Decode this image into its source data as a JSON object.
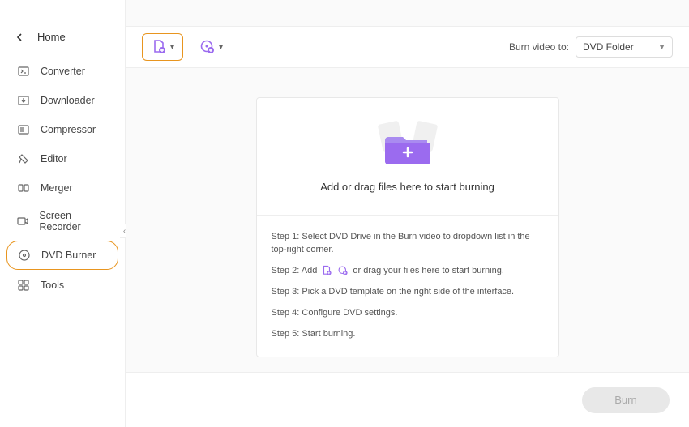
{
  "titlebar": {
    "avatar_icon": "user-avatar",
    "headset_icon": "headset-icon",
    "menu_icon": "hamburger-icon"
  },
  "sidebar": {
    "home_label": "Home",
    "items": [
      {
        "icon": "converter-icon",
        "label": "Converter"
      },
      {
        "icon": "downloader-icon",
        "label": "Downloader"
      },
      {
        "icon": "compressor-icon",
        "label": "Compressor"
      },
      {
        "icon": "editor-icon",
        "label": "Editor"
      },
      {
        "icon": "merger-icon",
        "label": "Merger"
      },
      {
        "icon": "recorder-icon",
        "label": "Screen Recorder"
      },
      {
        "icon": "dvd-icon",
        "label": "DVD Burner"
      },
      {
        "icon": "tools-icon",
        "label": "Tools"
      }
    ],
    "active_index": 6
  },
  "toolbar": {
    "add_file_icon": "add-file-icon",
    "add_disc_icon": "add-disc-icon",
    "burn_to_label": "Burn video to:",
    "burn_to_value": "DVD Folder"
  },
  "drop": {
    "text": "Add or drag files here to start burning"
  },
  "steps": {
    "s1": "Step 1: Select DVD Drive in the Burn video to dropdown list in the top-right corner.",
    "s2a": "Step 2: Add",
    "s2b": "or drag your files here to start burning.",
    "s3": "Step 3: Pick a DVD template on the right side of the interface.",
    "s4": "Step 4: Configure DVD settings.",
    "s5": "Step 5: Start burning."
  },
  "footer": {
    "burn_label": "Burn"
  },
  "colors": {
    "accent": "#9b6bef",
    "highlight": "#e8951f",
    "avatar": "#f5a623"
  }
}
